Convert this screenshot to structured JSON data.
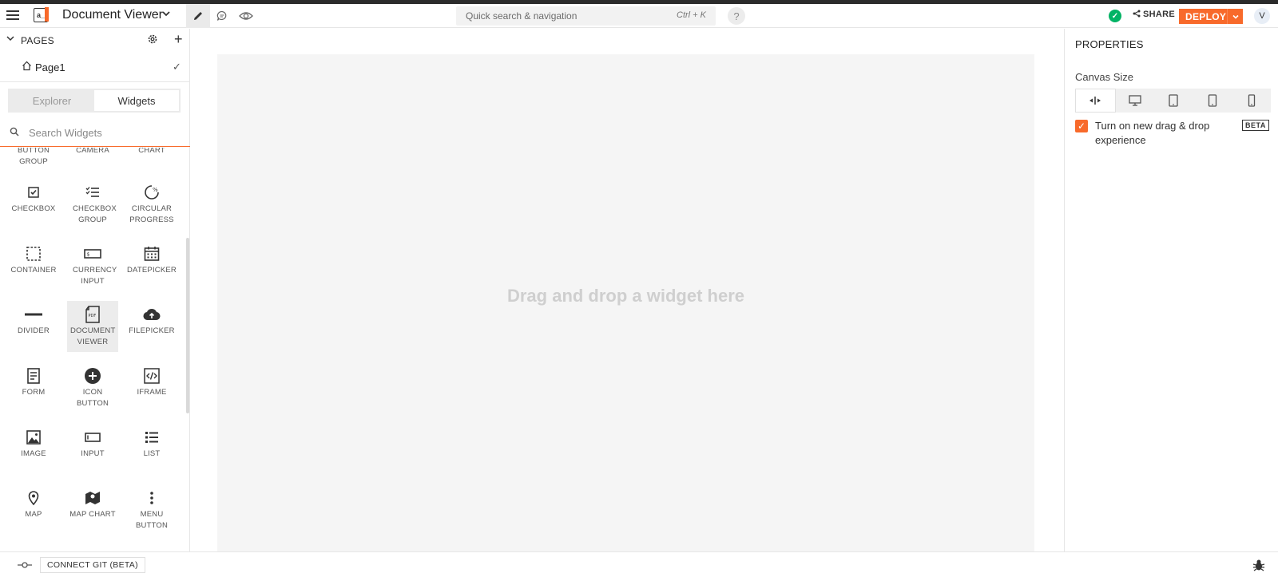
{
  "header": {
    "app_name": "Document Viewer",
    "search_placeholder": "Quick search & navigation",
    "search_shortcut": "Ctrl + K",
    "help": "?",
    "share_label": "SHARE",
    "deploy_label": "DEPLOY",
    "avatar_initial": "V"
  },
  "sidebar": {
    "pages_title": "PAGES",
    "page_name": "Page1",
    "tabs": [
      "Explorer",
      "Widgets"
    ],
    "search_placeholder": "Search Widgets",
    "partial_widgets": [
      {
        "name": "button-group",
        "label": "BUTTON GROUP"
      },
      {
        "name": "camera",
        "label": "CAMERA"
      },
      {
        "name": "chart",
        "label": "CHART"
      }
    ],
    "widgets": [
      {
        "name": "checkbox",
        "label": "CHECKBOX",
        "icon": "checkbox-icon"
      },
      {
        "name": "checkbox-group",
        "label": "CHECKBOX GROUP",
        "icon": "checklist-icon"
      },
      {
        "name": "circular-progress",
        "label": "CIRCULAR PROGRESS",
        "icon": "circular-progress-icon"
      },
      {
        "name": "container",
        "label": "CONTAINER",
        "icon": "container-icon"
      },
      {
        "name": "currency-input",
        "label": "CURRENCY INPUT",
        "icon": "currency-icon"
      },
      {
        "name": "datepicker",
        "label": "DATEPICKER",
        "icon": "calendar-icon"
      },
      {
        "name": "divider",
        "label": "DIVIDER",
        "icon": "divider-icon"
      },
      {
        "name": "document-viewer",
        "label": "DOCUMENT VIEWER",
        "icon": "pdf-icon"
      },
      {
        "name": "filepicker",
        "label": "FILEPICKER",
        "icon": "cloud-upload-icon"
      },
      {
        "name": "form",
        "label": "FORM",
        "icon": "form-icon"
      },
      {
        "name": "icon-button",
        "label": "ICON BUTTON",
        "icon": "plus-circle-icon"
      },
      {
        "name": "iframe",
        "label": "IFRAME",
        "icon": "code-icon"
      },
      {
        "name": "image",
        "label": "IMAGE",
        "icon": "image-icon"
      },
      {
        "name": "input",
        "label": "INPUT",
        "icon": "input-icon"
      },
      {
        "name": "list",
        "label": "LIST",
        "icon": "list-icon"
      },
      {
        "name": "map",
        "label": "MAP",
        "icon": "map-pin-icon"
      },
      {
        "name": "map-chart",
        "label": "MAP CHART",
        "icon": "map-chart-icon"
      },
      {
        "name": "menu-button",
        "label": "MENU BUTTON",
        "icon": "kebab-icon"
      }
    ],
    "selected_widget": "DOCUMENT VIEWER"
  },
  "canvas": {
    "placeholder": "Drag and drop a widget here"
  },
  "properties": {
    "title": "PROPERTIES",
    "canvas_size_label": "Canvas Size",
    "drag_drop_label": "Turn on new drag & drop experience",
    "drag_drop_checked": true,
    "beta_badge": "BETA"
  },
  "footer": {
    "connect_git_label": "CONNECT GIT (BETA)"
  },
  "colors": {
    "accent": "#f86a2b",
    "success": "#03b365"
  }
}
